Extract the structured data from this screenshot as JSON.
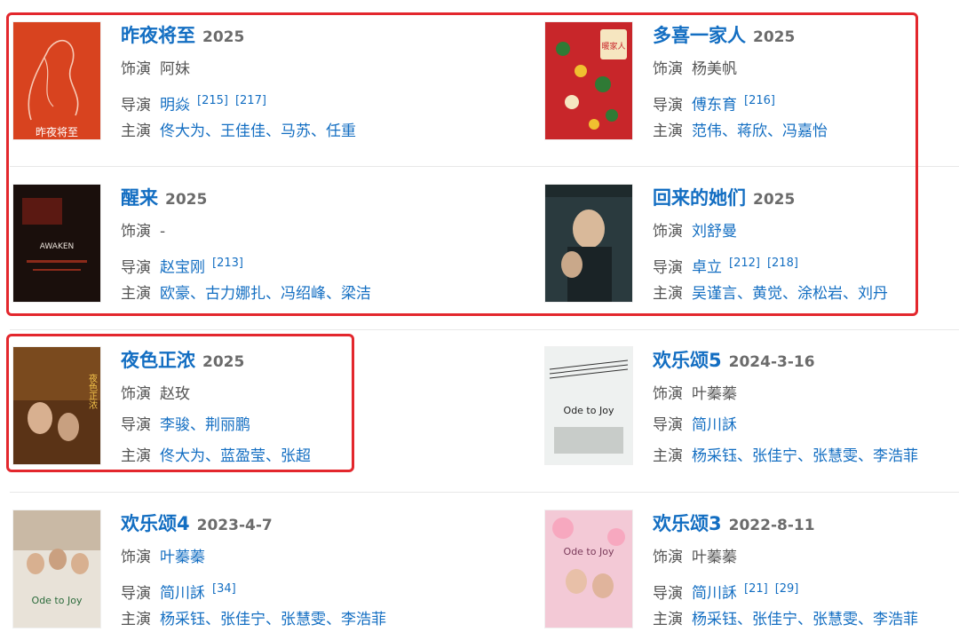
{
  "colors": {
    "link": "#136ec2",
    "muted": "#555555",
    "year": "#6b6b6b",
    "highlight": "#e3272d"
  },
  "labels": {
    "role": "饰演",
    "director": "导演",
    "cast": "主演"
  },
  "works": [
    {
      "title": "昨夜将至",
      "year": "2025",
      "role": "阿妹",
      "role_linked": false,
      "director": "明焱",
      "director_refs": [
        "[215]",
        "[217]"
      ],
      "cast": "佟大为、王佳佳、马苏、任重",
      "poster_text": "昨夜将至"
    },
    {
      "title": "多喜一家人",
      "year": "2025",
      "role": "杨美帆",
      "role_linked": false,
      "director": "傅东育",
      "director_refs": [
        "[216]"
      ],
      "cast": "范伟、蒋欣、冯嘉怡",
      "poster_text": "暖家人"
    },
    {
      "title": "醒来",
      "year": "2025",
      "role": "-",
      "role_linked": false,
      "director": "赵宝刚",
      "director_refs": [
        "[213]"
      ],
      "cast": "欧豪、古力娜扎、冯绍峰、梁洁",
      "poster_text": "AWAKEN"
    },
    {
      "title": "回来的她们",
      "year": "2025",
      "role": "刘舒曼",
      "role_linked": true,
      "director": "卓立",
      "director_refs": [
        "[212]",
        "[218]"
      ],
      "cast": "吴谨言、黄觉、涂松岩、刘丹",
      "poster_text": ""
    },
    {
      "title": "夜色正浓",
      "year": "2025",
      "role": "赵玫",
      "role_linked": false,
      "director": "李骏、荆丽鹏",
      "director_refs": [],
      "cast": "佟大为、蓝盈莹、张超",
      "poster_text": "夜色正浓"
    },
    {
      "title": "欢乐颂5",
      "year": "2024-3-16",
      "role": "叶蓁蓁",
      "role_linked": false,
      "director": "简川訸",
      "director_refs": [],
      "cast": "杨采钰、张佳宁、张慧雯、李浩菲",
      "poster_text": "Ode to Joy"
    },
    {
      "title": "欢乐颂4",
      "year": "2023-4-7",
      "role": "叶蓁蓁",
      "role_linked": true,
      "director": "简川訸",
      "director_refs": [
        "[34]"
      ],
      "cast": "杨采钰、张佳宁、张慧雯、李浩菲",
      "poster_text": "Ode to Joy"
    },
    {
      "title": "欢乐颂3",
      "year": "2022-8-11",
      "role": "叶蓁蓁",
      "role_linked": false,
      "director": "简川訸",
      "director_refs": [
        "[21]",
        "[29]"
      ],
      "cast": "杨采钰、张佳宁、张慧雯、李浩菲",
      "poster_text": "Ode to Joy"
    }
  ]
}
